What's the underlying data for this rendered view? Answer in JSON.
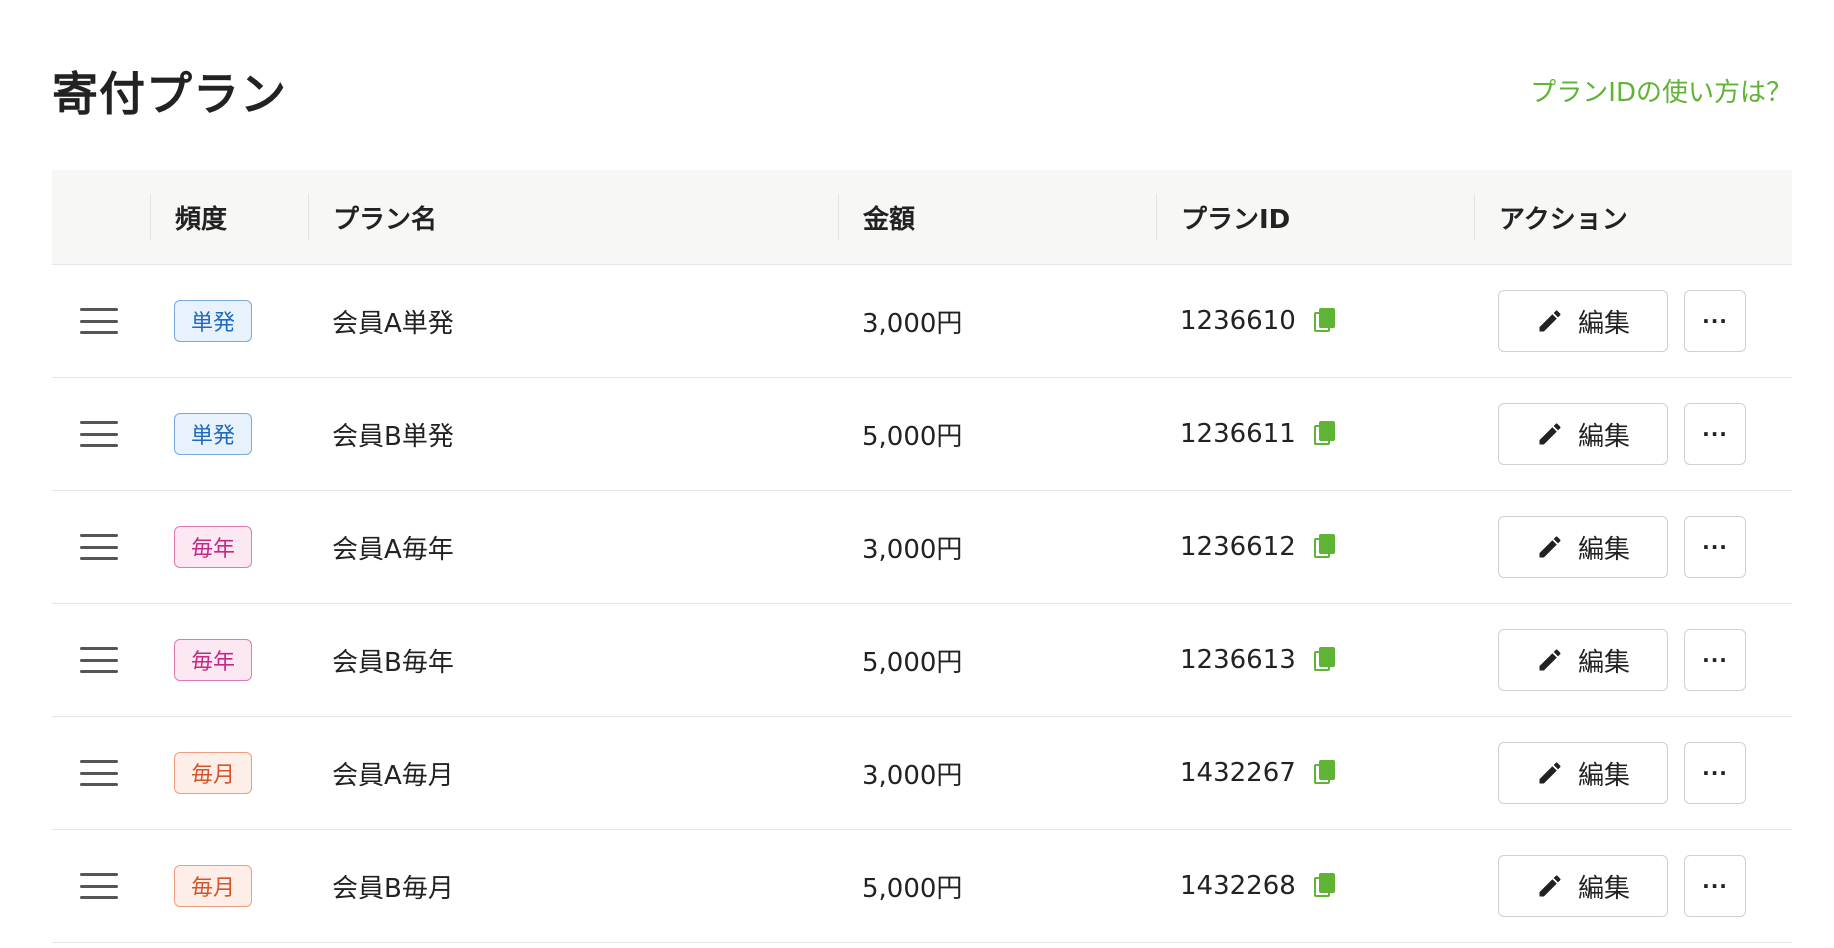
{
  "header": {
    "title": "寄付プラン",
    "help_link": "プランIDの使い方は？"
  },
  "colors": {
    "accent": "#5fb335",
    "badge_single": "#1f6bbf",
    "badge_yearly": "#c42a85",
    "badge_monthly": "#d4552b"
  },
  "table": {
    "columns": {
      "frequency": "頻度",
      "plan_name": "プラン名",
      "amount": "金額",
      "plan_id": "プランID",
      "action": "アクション"
    },
    "rows": [
      {
        "frequency": "単発",
        "frequency_type": "single",
        "plan_name": "会員A単発",
        "amount": "3,000円",
        "plan_id": "1236610",
        "edit_label": "編集",
        "more_label": "···"
      },
      {
        "frequency": "単発",
        "frequency_type": "single",
        "plan_name": "会員B単発",
        "amount": "5,000円",
        "plan_id": "1236611",
        "edit_label": "編集",
        "more_label": "···"
      },
      {
        "frequency": "毎年",
        "frequency_type": "yearly",
        "plan_name": "会員A毎年",
        "amount": "3,000円",
        "plan_id": "1236612",
        "edit_label": "編集",
        "more_label": "···"
      },
      {
        "frequency": "毎年",
        "frequency_type": "yearly",
        "plan_name": "会員B毎年",
        "amount": "5,000円",
        "plan_id": "1236613",
        "edit_label": "編集",
        "more_label": "···"
      },
      {
        "frequency": "毎月",
        "frequency_type": "monthly",
        "plan_name": "会員A毎月",
        "amount": "3,000円",
        "plan_id": "1432267",
        "edit_label": "編集",
        "more_label": "···"
      },
      {
        "frequency": "毎月",
        "frequency_type": "monthly",
        "plan_name": "会員B毎月",
        "amount": "5,000円",
        "plan_id": "1432268",
        "edit_label": "編集",
        "more_label": "···"
      }
    ]
  }
}
